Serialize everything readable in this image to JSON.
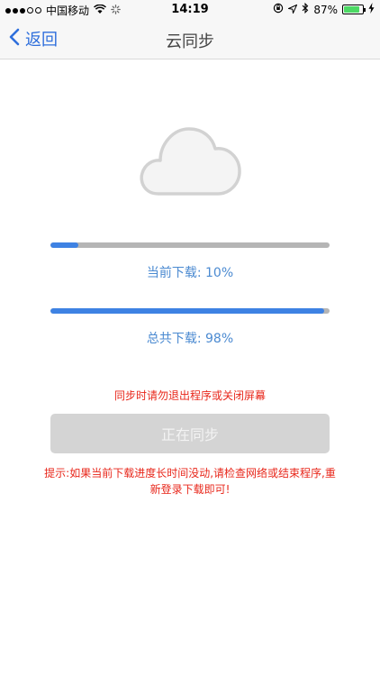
{
  "status_bar": {
    "carrier": "中国移动",
    "time": "14:19",
    "battery_text": "87%",
    "battery_level": 0.87
  },
  "nav": {
    "back_label": "返回",
    "title": "云同步"
  },
  "progress": {
    "current_label": "当前下载: 10%",
    "current_value": 0.1,
    "total_label": "总共下载: 98%",
    "total_value": 0.98
  },
  "warning": "同步时请勿退出程序或关闭屏幕",
  "sync_button": "正在同步",
  "tip": "提示:如果当前下载进度长时间没动,请检查网络或结束程序,重新登录下载即可!",
  "colors": {
    "accent": "#3e82e3",
    "warning": "#e8271b",
    "button_disabled": "#d4d4d4"
  }
}
